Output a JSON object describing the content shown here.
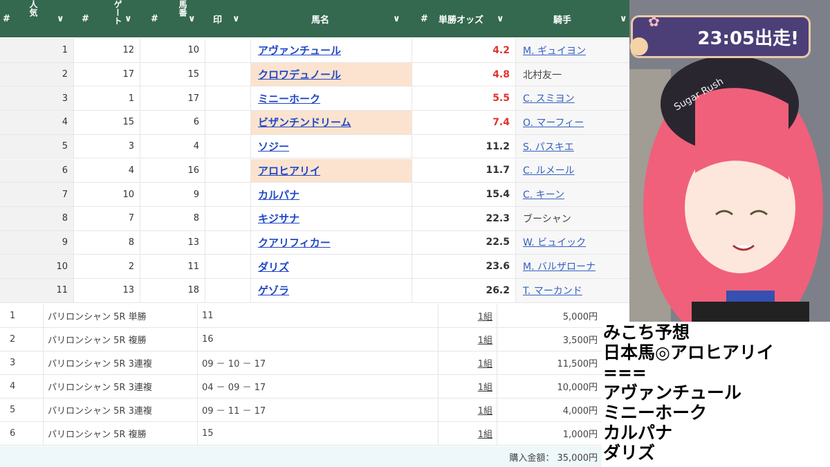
{
  "header": {
    "hash": "#",
    "popularity": "人気",
    "gate": "ゲート",
    "number": "馬番",
    "mark": "印",
    "horse_name": "馬名",
    "odds": "単勝オッズ",
    "jockey": "騎手",
    "sort": "∨"
  },
  "rows": [
    {
      "pop": "1",
      "gate": "12",
      "num": "10",
      "name": "アヴァンチュール",
      "hl": false,
      "odds": "4.2",
      "red": true,
      "jockey": "M. ギュイヨン",
      "link": true
    },
    {
      "pop": "2",
      "gate": "17",
      "num": "15",
      "name": "クロワデュノール",
      "hl": true,
      "odds": "4.8",
      "red": true,
      "jockey": "北村友一",
      "link": false
    },
    {
      "pop": "3",
      "gate": "1",
      "num": "17",
      "name": "ミニーホーク",
      "hl": false,
      "odds": "5.5",
      "red": true,
      "jockey": "C. スミヨン",
      "link": true
    },
    {
      "pop": "4",
      "gate": "15",
      "num": "6",
      "name": "ビザンチンドリーム",
      "hl": true,
      "odds": "7.4",
      "red": true,
      "jockey": "O. マーフィー",
      "link": true
    },
    {
      "pop": "5",
      "gate": "3",
      "num": "4",
      "name": "ソジー",
      "hl": false,
      "odds": "11.2",
      "red": false,
      "jockey": "S. パスキエ",
      "link": true
    },
    {
      "pop": "6",
      "gate": "4",
      "num": "16",
      "name": "アロヒアリイ",
      "hl": true,
      "odds": "11.7",
      "red": false,
      "jockey": "C. ルメール",
      "link": true
    },
    {
      "pop": "7",
      "gate": "10",
      "num": "9",
      "name": "カルパナ",
      "hl": false,
      "odds": "15.4",
      "red": false,
      "jockey": "C. キーン",
      "link": true
    },
    {
      "pop": "8",
      "gate": "7",
      "num": "8",
      "name": "キジサナ",
      "hl": false,
      "odds": "22.3",
      "red": false,
      "jockey": "ブーシャン",
      "link": false
    },
    {
      "pop": "9",
      "gate": "8",
      "num": "13",
      "name": "クアリフィカー",
      "hl": false,
      "odds": "22.5",
      "red": false,
      "jockey": "W. ビュイック",
      "link": true
    },
    {
      "pop": "10",
      "gate": "2",
      "num": "11",
      "name": "ダリズ",
      "hl": false,
      "odds": "23.6",
      "red": false,
      "jockey": "M. バルザローナ",
      "link": true
    },
    {
      "pop": "11",
      "gate": "13",
      "num": "18",
      "name": "ゲゾラ",
      "hl": false,
      "odds": "26.2",
      "red": false,
      "jockey": "T. マーカンド",
      "link": true
    }
  ],
  "bets": [
    {
      "no": "1",
      "race": "パリロンシャン 5R 単勝",
      "combo": "11",
      "units": "1組",
      "amount": "5,000円"
    },
    {
      "no": "2",
      "race": "パリロンシャン 5R 複勝",
      "combo": "16",
      "units": "1組",
      "amount": "3,500円"
    },
    {
      "no": "3",
      "race": "パリロンシャン 5R 3連複",
      "combo": "09 － 10 － 17",
      "units": "1組",
      "amount": "11,500円"
    },
    {
      "no": "4",
      "race": "パリロンシャン 5R 3連複",
      "combo": "04 － 09 － 17",
      "units": "1組",
      "amount": "10,000円"
    },
    {
      "no": "5",
      "race": "パリロンシャン 5R 3連複",
      "combo": "09 － 11 － 17",
      "units": "1組",
      "amount": "4,000円"
    },
    {
      "no": "6",
      "race": "パリロンシャン 5R 複勝",
      "combo": "15",
      "units": "1組",
      "amount": "1,000円"
    }
  ],
  "total": "購入金額： 35,000円",
  "timer": "23:05出走!",
  "cap_text": "Sugar Rush",
  "memo": [
    "みこち予想",
    "日本馬◎アロヒアリイ",
    "===",
    "アヴァンチュール",
    "ミニーホーク",
    "カルパナ",
    "ダリズ"
  ]
}
